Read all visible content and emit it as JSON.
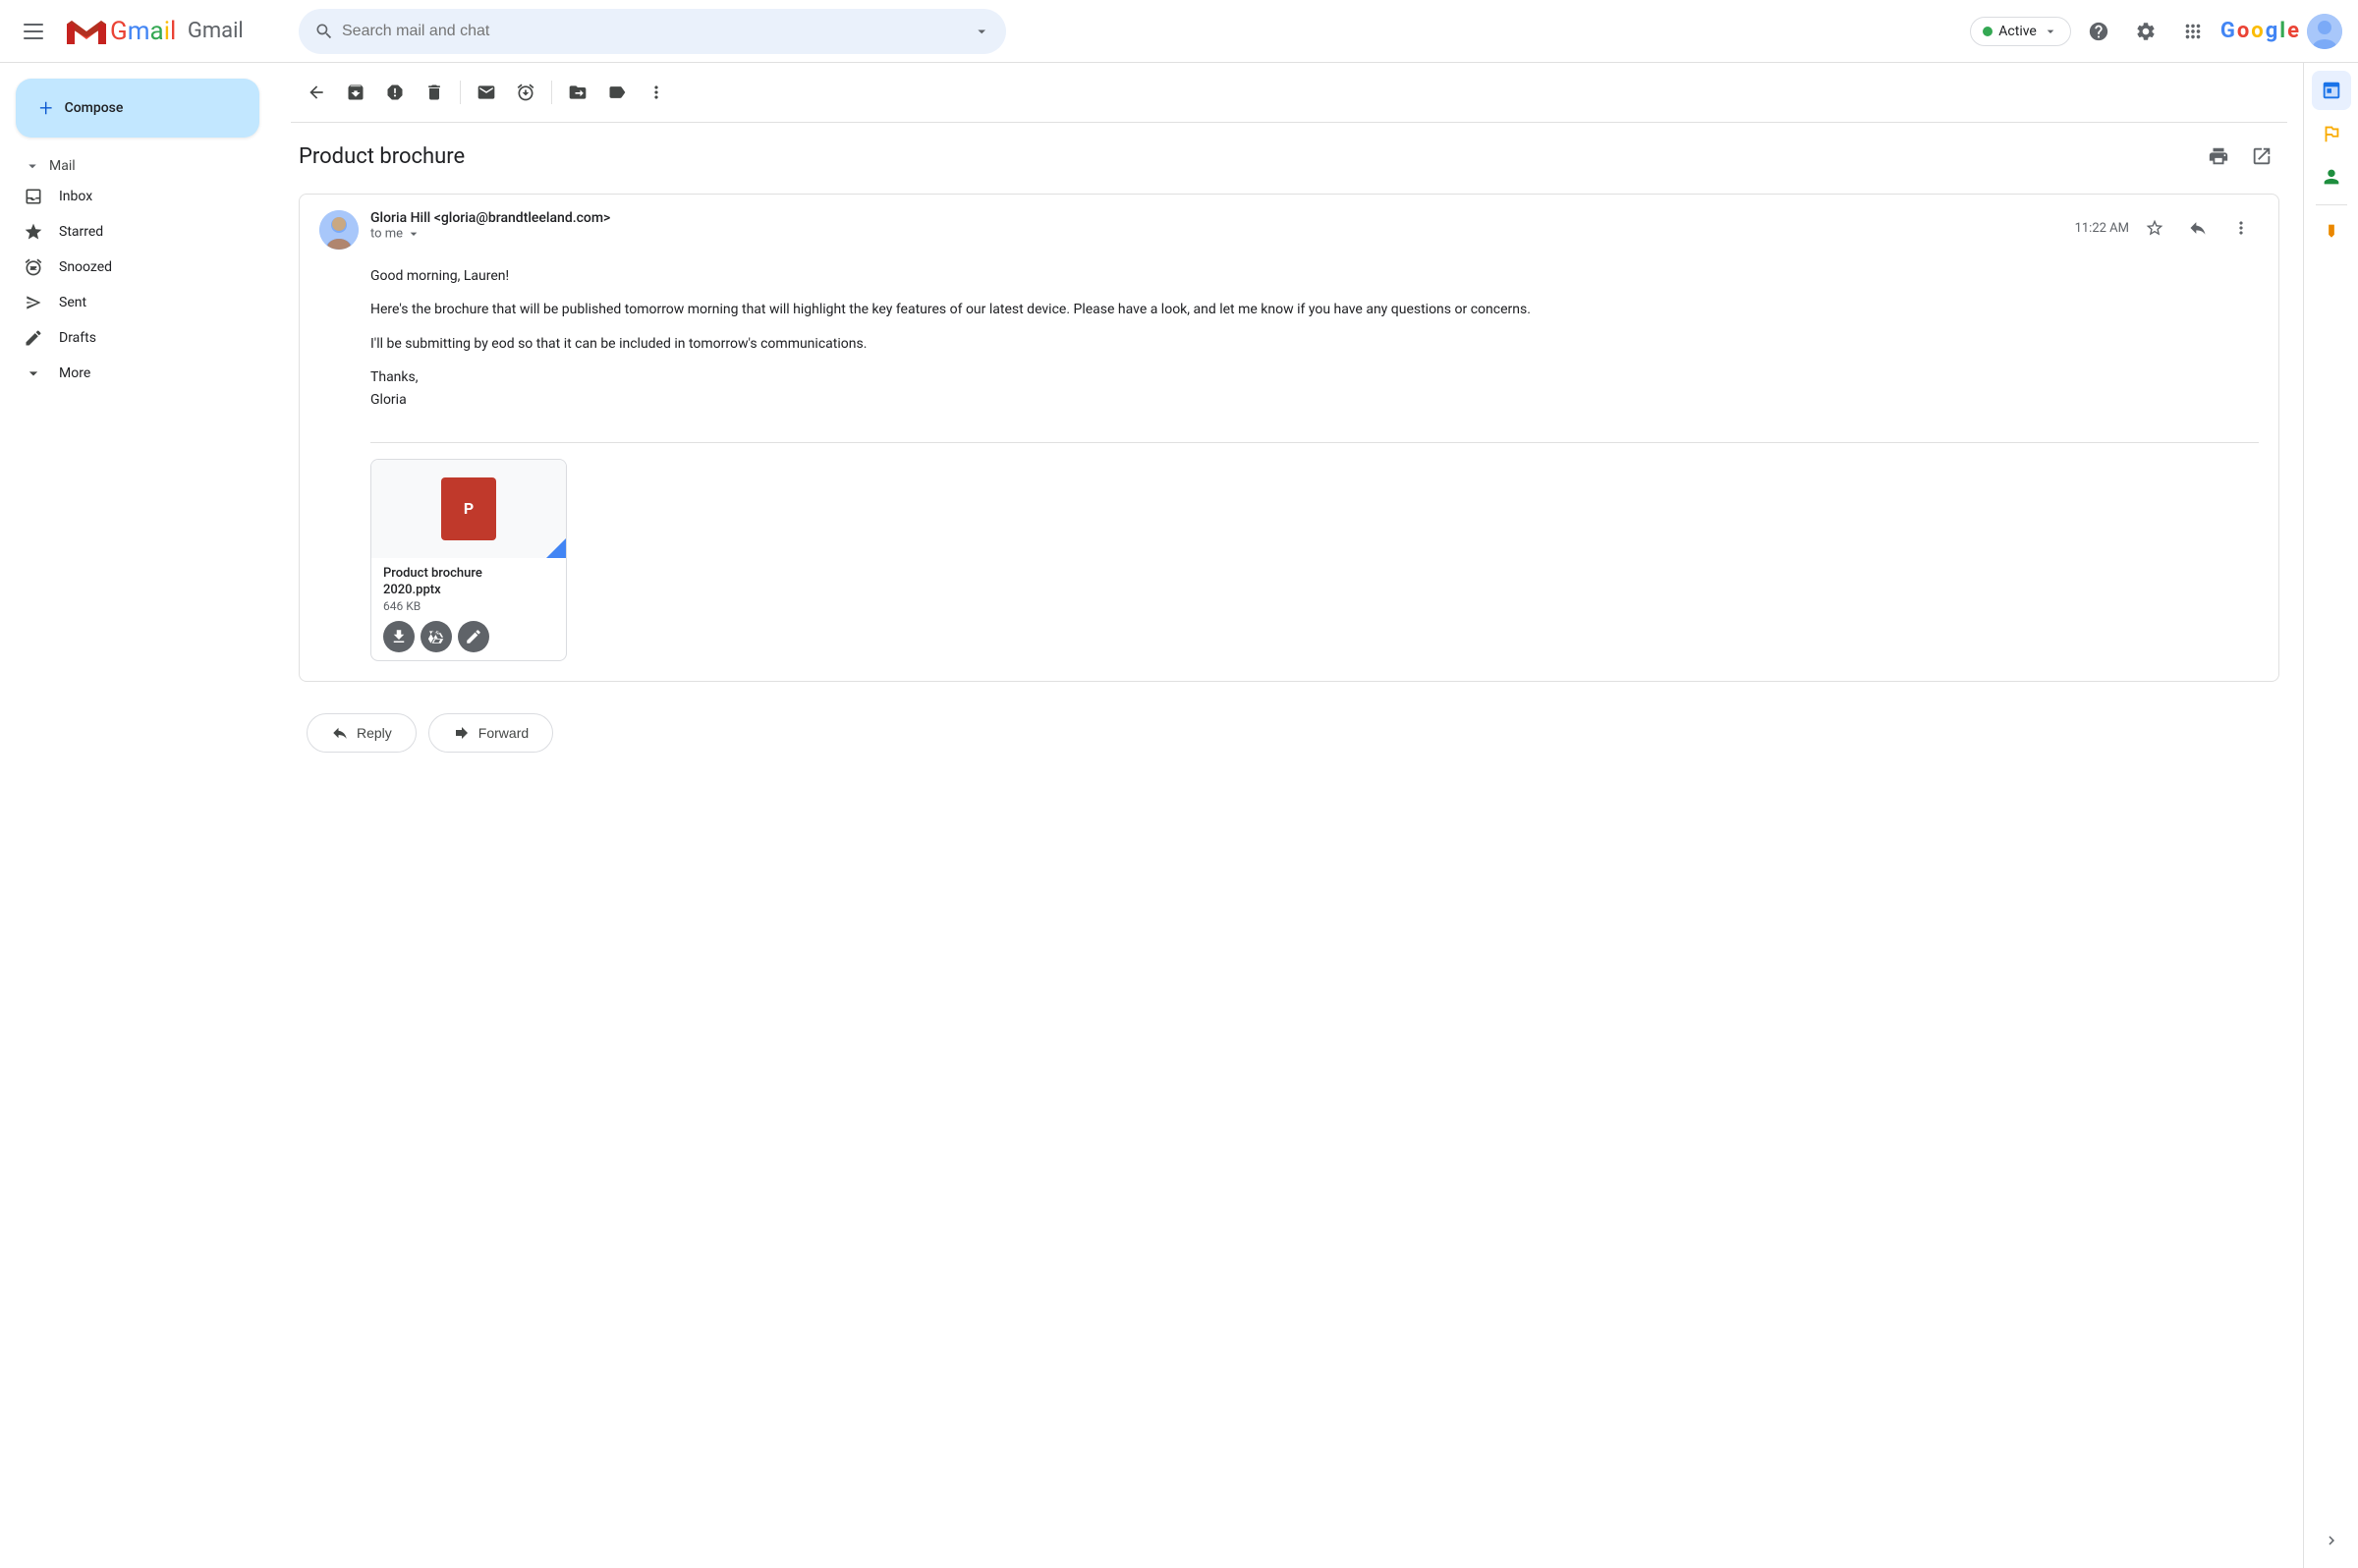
{
  "topbar": {
    "menu_label": "Main menu",
    "app_name": "Gmail",
    "search_placeholder": "Search mail and chat",
    "active_status": "Active",
    "help_label": "Help",
    "settings_label": "Settings",
    "apps_label": "Google apps",
    "account_label": "Google Account"
  },
  "compose": {
    "label": "Compose",
    "plus_symbol": "+"
  },
  "sidebar": {
    "mail_section": "Mail",
    "items": [
      {
        "id": "inbox",
        "label": "Inbox",
        "icon": "inbox"
      },
      {
        "id": "starred",
        "label": "Starred",
        "icon": "star"
      },
      {
        "id": "snoozed",
        "label": "Snoozed",
        "icon": "clock"
      },
      {
        "id": "sent",
        "label": "Sent",
        "icon": "send"
      },
      {
        "id": "drafts",
        "label": "Drafts",
        "icon": "draft"
      },
      {
        "id": "more",
        "label": "More",
        "icon": "expand"
      }
    ]
  },
  "toolbar": {
    "back_label": "Back",
    "archive_label": "Archive",
    "report_spam_label": "Report spam",
    "delete_label": "Delete",
    "mark_unread_label": "Mark as unread",
    "snooze_label": "Snooze",
    "move_to_label": "Move to",
    "label_as_label": "Label as",
    "more_label": "More"
  },
  "email": {
    "subject": "Product brochure",
    "print_label": "Print",
    "open_in_new_label": "Open in new window",
    "sender_name": "Gloria Hill",
    "sender_email": "gloria@brandtleeland.com",
    "sender_full": "Gloria Hill <gloria@brandtleeland.com>",
    "to": "to me",
    "timestamp": "11:22 AM",
    "body_lines": [
      "Good morning, Lauren!",
      "",
      "Here's the brochure that will be published tomorrow morning that will highlight the key features of our latest device. Please have a look, and let me know if you have any questions or concerns.",
      "",
      "I'll be submitting by eod so that it can be included in tomorrow's communications.",
      "",
      "Thanks,",
      "Gloria"
    ],
    "attachment": {
      "name": "Product brochure 2020.pptx",
      "name_line1": "Product brochure",
      "name_line2": "2020.pptx",
      "size": "646 KB",
      "type": "P",
      "download_label": "Download",
      "save_to_drive_label": "Save to Drive",
      "edit_label": "Edit"
    },
    "reply_label": "Reply",
    "forward_label": "Forward"
  },
  "right_panel": {
    "calendar_label": "Google Calendar",
    "tasks_label": "Google Tasks",
    "contacts_label": "Google Contacts",
    "expand_label": "Expand"
  }
}
